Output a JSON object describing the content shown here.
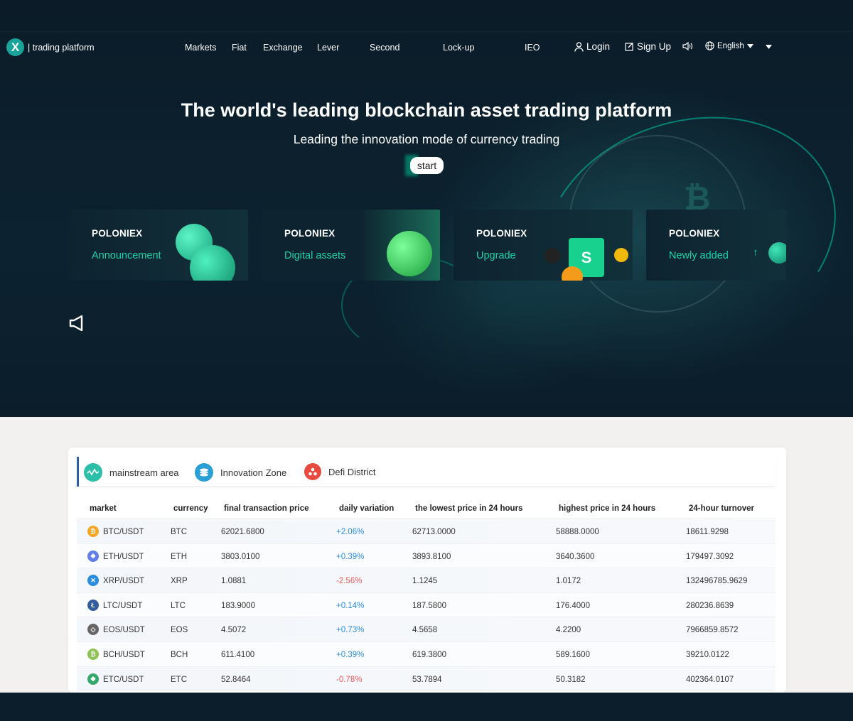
{
  "brand": {
    "logo_letter": "X",
    "name": "| trading platform"
  },
  "nav": {
    "items": [
      "Markets",
      "Fiat",
      "Exchange",
      "Lever",
      "Second",
      "Lock-up",
      "IEO"
    ],
    "login": "Login",
    "signup": "Sign Up",
    "language": "English"
  },
  "hero": {
    "title": "The world's leading blockchain asset trading platform",
    "subtitle": "Leading the innovation mode of currency trading",
    "start_label": "start"
  },
  "cards": [
    {
      "brand": "POLONIEX",
      "label": "Announcement"
    },
    {
      "brand": "POLONIEX",
      "label": "Digital assets"
    },
    {
      "brand": "POLONIEX",
      "label": "Upgrade"
    },
    {
      "brand": "POLONIEX",
      "label": "Newly added"
    }
  ],
  "tabs": [
    {
      "label": "mainstream area",
      "icon": "mainstream-icon",
      "color": "#2bbfa8"
    },
    {
      "label": "Innovation Zone",
      "icon": "innovation-icon",
      "color": "#2a9fd6"
    },
    {
      "label": "Defi District",
      "icon": "defi-icon",
      "color": "#e84a3f"
    }
  ],
  "table": {
    "headers": [
      "market",
      "currency",
      "final transaction price",
      "daily variation",
      "the lowest price in 24 hours",
      "highest price in 24 hours",
      "24-hour turnover"
    ],
    "rows": [
      {
        "market": "BTC/USDT",
        "currency": "BTC",
        "price": "62021.6800",
        "change": "+2.06%",
        "direction": "up",
        "low": "62713.0000",
        "high": "58888.0000",
        "turnover": "18611.9298",
        "icon_color": "#f5a623",
        "icon": "btc-icon"
      },
      {
        "market": "ETH/USDT",
        "currency": "ETH",
        "price": "3803.0100",
        "change": "+0.39%",
        "direction": "up",
        "low": "3893.8100",
        "high": "3640.3600",
        "turnover": "179497.3092",
        "icon_color": "#627eea",
        "icon": "eth-icon"
      },
      {
        "market": "XRP/USDT",
        "currency": "XRP",
        "price": "1.0881",
        "change": "-2.56%",
        "direction": "down",
        "low": "1.1245",
        "high": "1.0172",
        "turnover": "132496785.9629",
        "icon_color": "#2a8de0",
        "icon": "xrp-icon"
      },
      {
        "market": "LTC/USDT",
        "currency": "LTC",
        "price": "183.9000",
        "change": "+0.14%",
        "direction": "up",
        "low": "187.5800",
        "high": "176.4000",
        "turnover": "280236.8639",
        "icon_color": "#345d9d",
        "icon": "ltc-icon"
      },
      {
        "market": "EOS/USDT",
        "currency": "EOS",
        "price": "4.5072",
        "change": "+0.73%",
        "direction": "up",
        "low": "4.5658",
        "high": "4.2200",
        "turnover": "7966859.8572",
        "icon_color": "#666666",
        "icon": "eos-icon"
      },
      {
        "market": "BCH/USDT",
        "currency": "BCH",
        "price": "611.4100",
        "change": "+0.39%",
        "direction": "up",
        "low": "619.3800",
        "high": "589.1600",
        "turnover": "39210.0122",
        "icon_color": "#8dc351",
        "icon": "bch-icon"
      },
      {
        "market": "ETC/USDT",
        "currency": "ETC",
        "price": "52.8464",
        "change": "-0.78%",
        "direction": "down",
        "low": "53.7894",
        "high": "50.3182",
        "turnover": "402364.0107",
        "icon_color": "#33a86b",
        "icon": "etc-icon"
      }
    ]
  }
}
